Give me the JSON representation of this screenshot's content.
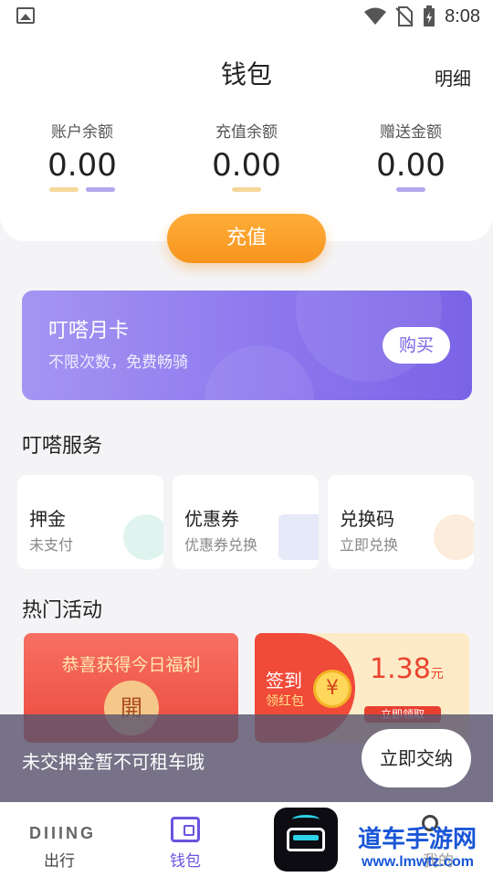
{
  "status_bar": {
    "time": "8:08"
  },
  "header": {
    "title": "钱包",
    "detail_link": "明细"
  },
  "balances": [
    {
      "label": "账户余额",
      "amount": "0.00"
    },
    {
      "label": "充值余额",
      "amount": "0.00"
    },
    {
      "label": "赠送金额",
      "amount": "0.00"
    }
  ],
  "recharge_button": "充值",
  "monthly_card": {
    "title": "叮嗒月卡",
    "subtitle": "不限次数，免费畅骑",
    "buy_label": "购买"
  },
  "services": {
    "title": "叮嗒服务",
    "items": [
      {
        "title": "押金",
        "subtitle": "未支付"
      },
      {
        "title": "优惠券",
        "subtitle": "优惠券兑换"
      },
      {
        "title": "兑换码",
        "subtitle": "立即兑换"
      }
    ]
  },
  "hot_activities": {
    "title": "热门活动",
    "red_envelope": {
      "text": "恭喜获得今日福利",
      "seal": "開"
    },
    "sign_in": {
      "line1": "签到",
      "line2": "领红包",
      "coin": "¥",
      "amount": "1.38",
      "unit": "元",
      "claim": "立即领取"
    }
  },
  "toast": {
    "message": "未交押金暂不可租车哦",
    "button": "立即交纳"
  },
  "tabbar": {
    "brand": "DIIING",
    "tabs": [
      {
        "label": "出行"
      },
      {
        "label": "钱包"
      },
      {
        "label": "我的"
      }
    ]
  },
  "watermark": {
    "line1": "道车手游网",
    "line2": "www.lmwtz.com"
  },
  "colors": {
    "accent": "#7a63e6",
    "orange": "#f7941d",
    "red": "#ea4a3c"
  }
}
